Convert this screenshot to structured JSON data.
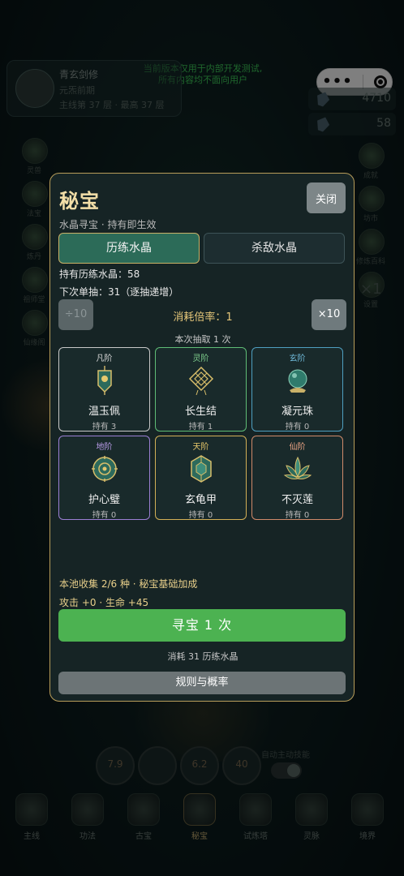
{
  "background": {
    "dev_notice_line1": "当前版本仅用于内部开发测试,",
    "dev_notice_line2": "所有内容均不面向用户",
    "player": {
      "name": "青玄剑修",
      "realm": "元炁前期",
      "floor": "主线第 37 层 · 最高 37 层"
    },
    "resources": [
      {
        "value": "4710",
        "icon": "spirit-stone-icon"
      },
      {
        "value": "58",
        "icon": "crystal-icon"
      }
    ],
    "left_side": [
      {
        "label": "灵兽"
      },
      {
        "label": "法宝"
      },
      {
        "label": "炼丹"
      },
      {
        "label": "祖师堂"
      },
      {
        "label": "仙缘阁"
      }
    ],
    "right_side": [
      {
        "label": "成就"
      },
      {
        "label": "坊市"
      },
      {
        "label": "修炼百科"
      },
      {
        "label": "设置"
      }
    ],
    "speed": "×1",
    "skills": [
      "7.9",
      "",
      "6.2",
      "40"
    ],
    "auto_skill_label": "自动主动技能",
    "bottom_nav": [
      {
        "label": "主线"
      },
      {
        "label": "功法"
      },
      {
        "label": "古宝"
      },
      {
        "label": "秘宝",
        "active": true
      },
      {
        "label": "试炼塔"
      },
      {
        "label": "灵脉"
      },
      {
        "label": "境界"
      }
    ]
  },
  "modal": {
    "title": "秘宝",
    "close_label": "关闭",
    "subtitle": "水晶寻宝 · 持有即生效",
    "tabs": [
      {
        "label": "历练水晶",
        "active": true
      },
      {
        "label": "杀敌水晶",
        "active": false
      }
    ],
    "held_text": "持有历练水晶：58",
    "next_draw_text": "下次单抽：31（逐抽递增）",
    "divide_label": "÷10",
    "multiply_label": "×10",
    "multiplier_text": "消耗倍率：1",
    "draw_count_text": "本次抽取 1 次",
    "items": [
      {
        "tier": "凡阶",
        "name": "温玉佩",
        "owned": "持有 3",
        "tier_color": "#d6d6d6",
        "border": "#c8c8c8",
        "icon": "jade-pendant-icon"
      },
      {
        "tier": "灵阶",
        "name": "长生结",
        "owned": "持有 1",
        "tier_color": "#7fd08e",
        "border": "#5fbd76",
        "icon": "longevity-knot-icon"
      },
      {
        "tier": "玄阶",
        "name": "凝元珠",
        "owned": "持有 0",
        "tier_color": "#6fb9d8",
        "border": "#4f9fc0",
        "icon": "orb-icon"
      },
      {
        "tier": "地阶",
        "name": "护心璧",
        "owned": "持有 0",
        "tier_color": "#b79be6",
        "border": "#9b7fd4",
        "icon": "heart-guard-disc-icon"
      },
      {
        "tier": "天阶",
        "name": "玄龟甲",
        "owned": "持有 0",
        "tier_color": "#e8c86a",
        "border": "#d3b057",
        "icon": "turtle-shell-icon"
      },
      {
        "tier": "仙阶",
        "name": "不灭莲",
        "owned": "持有 0",
        "tier_color": "#e9a283",
        "border": "#d08a6a",
        "icon": "lotus-icon"
      }
    ],
    "collection_text": "本池收集 2/6 种 · 秘宝基础加成",
    "bonus_text": "攻击 +0 · 生命 +45",
    "draw_button_label": "寻宝 1 次",
    "cost_text": "消耗 31 历练水晶",
    "rules_label": "规则与概率"
  }
}
